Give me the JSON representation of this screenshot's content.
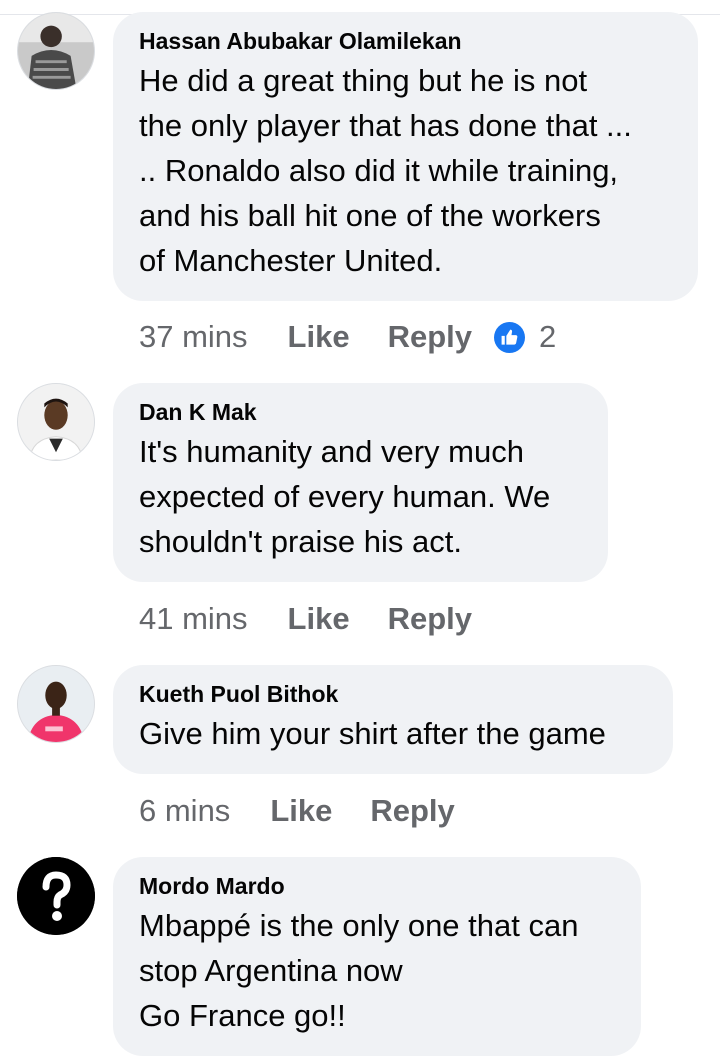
{
  "comments": [
    {
      "author": "Hassan Abubakar Olamilekan",
      "avatar": "user-photo",
      "lines": [
        "He did a great thing but he is not",
        "the only player that has done that ...",
        "..  Ronaldo also did it while training,",
        "and his ball hit one of the workers",
        "of Manchester United."
      ],
      "time": "37 mins",
      "like_label": "Like",
      "reply_label": "Reply",
      "reaction": {
        "icon": "thumbs-up-icon",
        "color": "#1877f2",
        "count": "2"
      }
    },
    {
      "author": "Dan K Mak",
      "avatar": "user-photo",
      "lines": [
        "It's humanity and very much",
        "expected of every human. We",
        "shouldn't praise his act."
      ],
      "time": "41 mins",
      "like_label": "Like",
      "reply_label": "Reply"
    },
    {
      "author": "Kueth Puol Bithok",
      "avatar": "user-photo",
      "lines": [
        "Give him your shirt after the game"
      ],
      "time": "6 mins",
      "like_label": "Like",
      "reply_label": "Reply"
    },
    {
      "author": "Mordo Mardo",
      "avatar": "question-mark-icon",
      "lines": [
        "Mbappé is the only one that can",
        "stop Argentina now",
        "Go France go!!"
      ]
    }
  ],
  "colors": {
    "bubble": "#f0f2f5",
    "text": "#050505",
    "meta": "#65676b",
    "like_blue": "#1877f2"
  }
}
